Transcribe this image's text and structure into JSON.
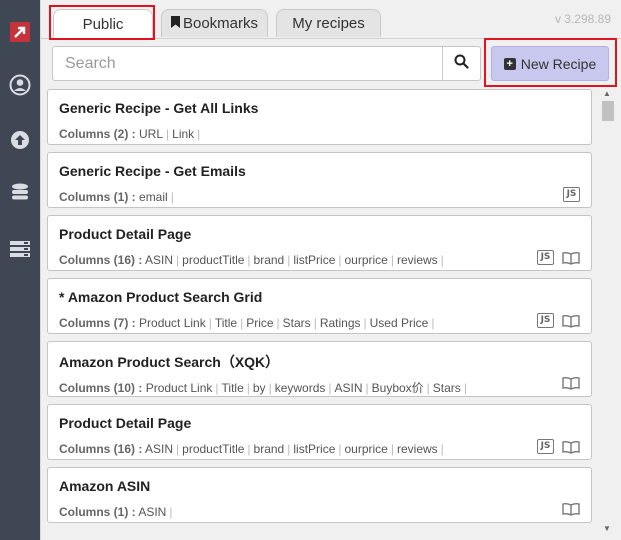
{
  "tabs": {
    "public": "Public",
    "bookmarks": "Bookmarks",
    "my_recipes": "My recipes"
  },
  "version": "v 3.298.89",
  "search": {
    "placeholder": "Search"
  },
  "new_recipe_label": "New Recipe",
  "columns_prefix": "Columns",
  "recipes": [
    {
      "title": "Generic Recipe - Get All Links",
      "count": "(2) :",
      "columns": [
        "URL",
        "Link"
      ],
      "js": false,
      "book": false
    },
    {
      "title": "Generic Recipe - Get Emails",
      "count": "(1) :",
      "columns": [
        "email"
      ],
      "js": true,
      "book": false
    },
    {
      "title": "Product Detail Page",
      "count": "(16) :",
      "columns": [
        "ASIN",
        "productTitle",
        "brand",
        "listPrice",
        "ourprice",
        "reviews"
      ],
      "js": true,
      "book": true
    },
    {
      "title": "* Amazon Product Search Grid",
      "count": "(7) :",
      "columns": [
        "Product Link",
        "Title",
        "Price",
        "Stars",
        "Ratings",
        "Used Price"
      ],
      "js": true,
      "book": true
    },
    {
      "title": "Amazon Product Search（XQK）",
      "count": "(10) :",
      "columns": [
        "Product Link",
        "Title",
        "by",
        "keywords",
        "ASIN",
        "Buybox价",
        "Stars"
      ],
      "js": false,
      "book": true
    },
    {
      "title": "Product Detail Page",
      "count": "(16) :",
      "columns": [
        "ASIN",
        "productTitle",
        "brand",
        "listPrice",
        "ourprice",
        "reviews"
      ],
      "js": true,
      "book": true
    },
    {
      "title": "Amazon ASIN",
      "count": "(1) :",
      "columns": [
        "ASIN"
      ],
      "js": false,
      "book": true
    }
  ],
  "js_badge": "JS",
  "colors": {
    "sidebar": "#3e4753",
    "new_recipe_bg": "#c8c8ef",
    "highlight": "#e0141e"
  },
  "icons": [
    "logo-icon",
    "user-icon",
    "upload-icon",
    "database-icon",
    "server-icon",
    "bookmark-icon",
    "search-icon",
    "plus-icon",
    "js-icon",
    "book-icon"
  ]
}
